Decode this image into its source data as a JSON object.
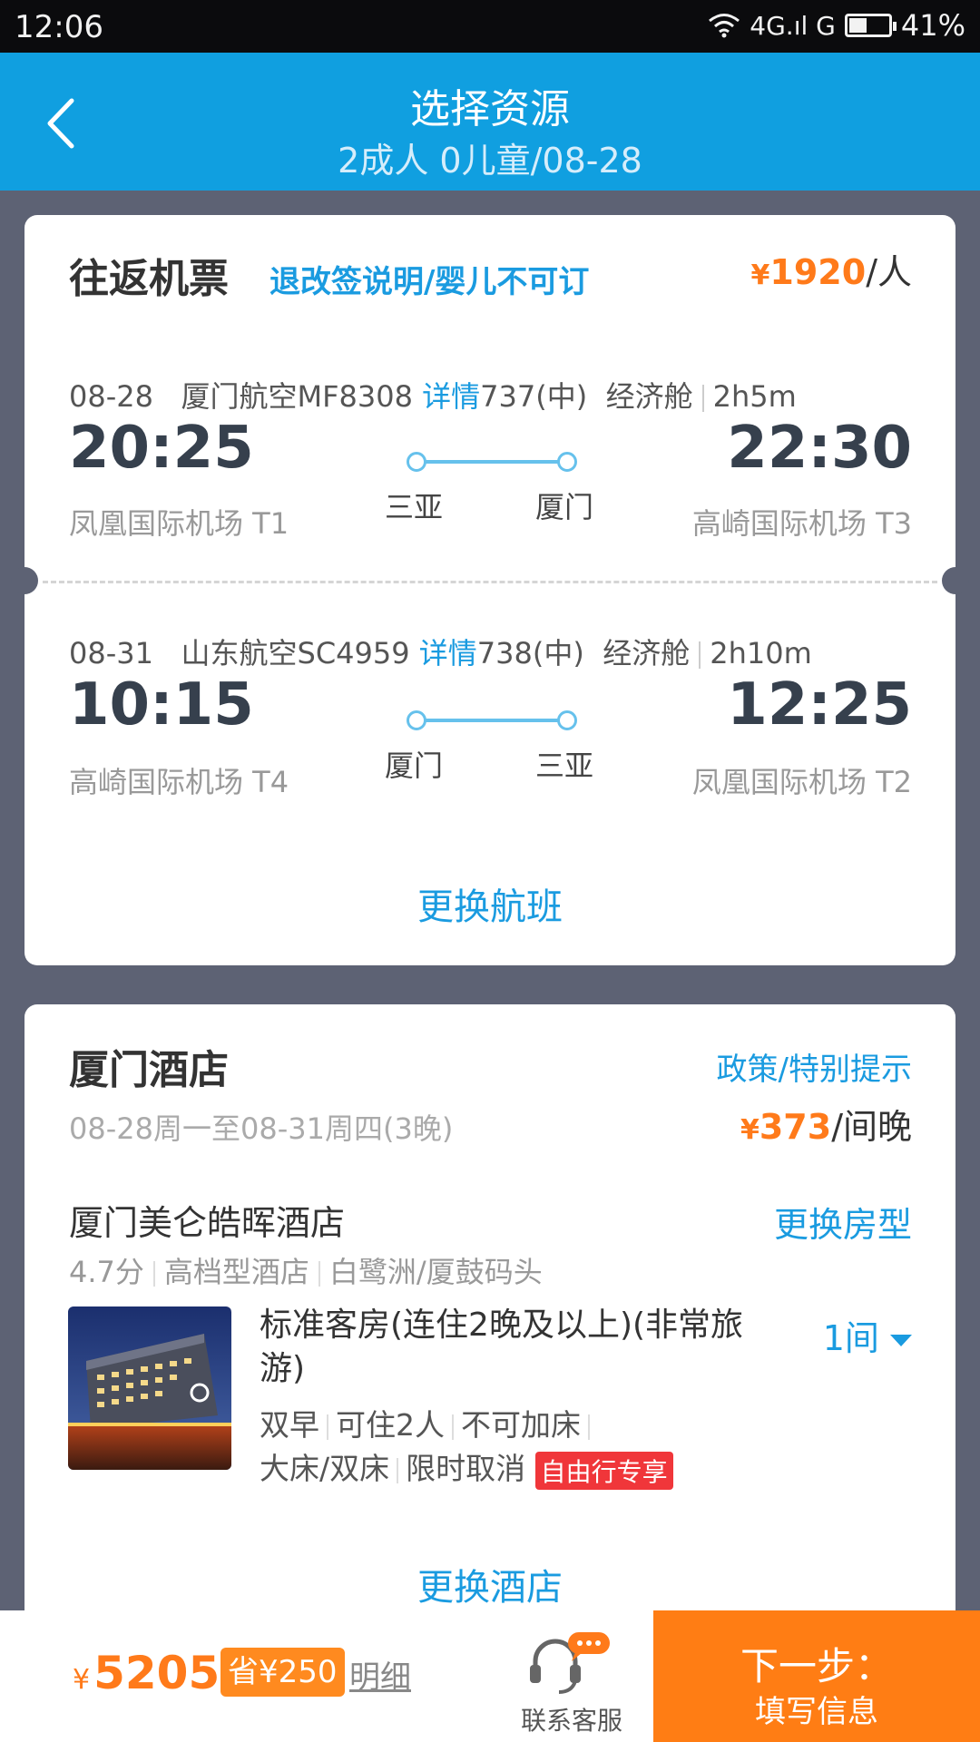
{
  "status_bar": {
    "time": "12:06",
    "network": "4G.ıl G",
    "battery": "41%",
    "battery_level": 0.41
  },
  "header": {
    "title": "选择资源",
    "subtitle": "2成人 0儿童/08-28"
  },
  "flights": {
    "title": "往返机票",
    "policy_link": "退改签说明/婴儿不可订",
    "price_symbol": "¥",
    "price": "1920",
    "price_unit": "/人",
    "segments": [
      {
        "date": "08-28",
        "airline_flight": "厦门航空MF8308",
        "detail_link": "详情",
        "aircraft": "737(中)",
        "cabin": "经济舱",
        "duration": "2h5m",
        "dep_time": "20:25",
        "dep_airport": "凤凰国际机场 T1",
        "from_city": "三亚",
        "to_city": "厦门",
        "arr_time": "22:30",
        "arr_airport": "高崎国际机场 T3"
      },
      {
        "date": "08-31",
        "airline_flight": "山东航空SC4959",
        "detail_link": "详情",
        "aircraft": "738(中)",
        "cabin": "经济舱",
        "duration": "2h10m",
        "dep_time": "10:15",
        "dep_airport": "高崎国际机场 T4",
        "from_city": "厦门",
        "to_city": "三亚",
        "arr_time": "12:25",
        "arr_airport": "凤凰国际机场 T2"
      }
    ],
    "change_label": "更换航班"
  },
  "hotel": {
    "title": "厦门酒店",
    "policy_link": "政策/特别提示",
    "dates": "08-28周一至08-31周四(3晚)",
    "price_symbol": "¥",
    "price": "373",
    "price_unit": "/间晚",
    "name": "厦门美仑皓晖酒店",
    "change_room_label": "更换房型",
    "score": "4.7分",
    "level": "高档型酒店",
    "area": "白鹭洲/厦鼓码头",
    "room_name": "标准客房(连住2晚及以上)(非常旅游)",
    "rooms_count": "1间",
    "features": [
      "双早",
      "可住2人",
      "不可加床",
      "大床/双床",
      "限时取消"
    ],
    "tag": "自由行专享",
    "change_hotel_label": "更换酒店"
  },
  "bottom": {
    "total_symbol": "¥",
    "total": "5205",
    "save": "省¥250",
    "detail_link": "明细",
    "service_label": "联系客服",
    "next_line1": "下一步：",
    "next_line2": "填写信息"
  },
  "colors": {
    "header_bg": "#109fe0",
    "accent_orange": "#ff7a1a",
    "link_blue": "#1a9be0",
    "tag_red": "#f0363a"
  }
}
